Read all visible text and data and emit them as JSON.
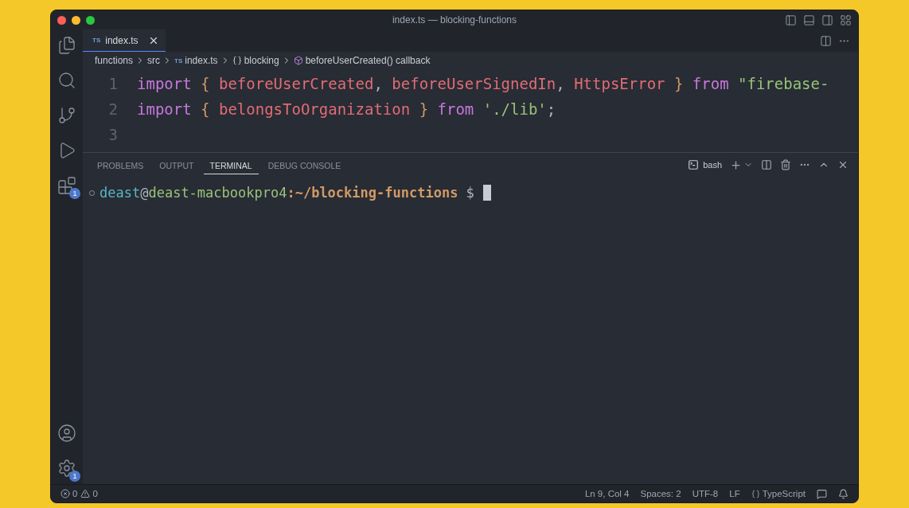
{
  "window": {
    "title": "index.ts — blocking-functions"
  },
  "activity_bar": {
    "top": [
      {
        "kind": "explorer"
      },
      {
        "kind": "search"
      },
      {
        "kind": "source-control"
      },
      {
        "kind": "run"
      },
      {
        "kind": "extensions",
        "badge": "1"
      }
    ],
    "bottom": [
      {
        "kind": "account"
      },
      {
        "kind": "settings",
        "badge": "1"
      }
    ]
  },
  "tabs": [
    {
      "icon_text": "TS",
      "label": "index.ts",
      "selected": true
    }
  ],
  "breadcrumb": [
    {
      "kind": "folder",
      "label": "functions"
    },
    {
      "kind": "folder",
      "label": "src"
    },
    {
      "kind": "file",
      "icon_text": "TS",
      "label": "index.ts"
    },
    {
      "kind": "variable",
      "label": "blocking"
    },
    {
      "kind": "method",
      "label": "beforeUserCreated() callback"
    }
  ],
  "editor": {
    "lines": [
      {
        "number": "1",
        "tokens": [
          {
            "kind": "keyword",
            "text": "import"
          },
          {
            "kind": "brace",
            "text": " { "
          },
          {
            "kind": "ident",
            "text": "beforeUserCreated"
          },
          {
            "kind": "plain",
            "text": ", "
          },
          {
            "kind": "ident",
            "text": "beforeUserSignedIn"
          },
          {
            "kind": "plain",
            "text": ", "
          },
          {
            "kind": "ident",
            "text": "HttpsError"
          },
          {
            "kind": "brace",
            "text": " } "
          },
          {
            "kind": "keyword",
            "text": "from"
          },
          {
            "kind": "string",
            "text": " \"firebase-"
          }
        ]
      },
      {
        "number": "2",
        "tokens": [
          {
            "kind": "keyword",
            "text": "import"
          },
          {
            "kind": "brace",
            "text": " { "
          },
          {
            "kind": "ident",
            "text": "belongsToOrganization"
          },
          {
            "kind": "brace",
            "text": " } "
          },
          {
            "kind": "keyword",
            "text": "from"
          },
          {
            "kind": "string",
            "text": " './lib'"
          },
          {
            "kind": "plain",
            "text": ";"
          }
        ]
      },
      {
        "number": "3"
      }
    ]
  },
  "panel": {
    "tabs": [
      {
        "label": "PROBLEMS",
        "selected": false
      },
      {
        "label": "OUTPUT",
        "selected": false
      },
      {
        "label": "TERMINAL",
        "selected": true
      },
      {
        "label": "DEBUG CONSOLE",
        "selected": false
      }
    ],
    "terminal_name": "bash",
    "prompt": [
      {
        "kind": "user",
        "text": "deast"
      },
      {
        "kind": "plain",
        "text": "@"
      },
      {
        "kind": "host",
        "text": "deast-macbookpro4"
      },
      {
        "kind": "path",
        "text": ":~/blocking-functions"
      },
      {
        "kind": "plain",
        "text": " $"
      }
    ]
  },
  "status_bar": {
    "errors": "0",
    "warnings": "0",
    "items": [
      "Ln 9, Col 4",
      "Spaces: 2",
      "UTF-8",
      "LF"
    ],
    "language": "TypeScript"
  }
}
